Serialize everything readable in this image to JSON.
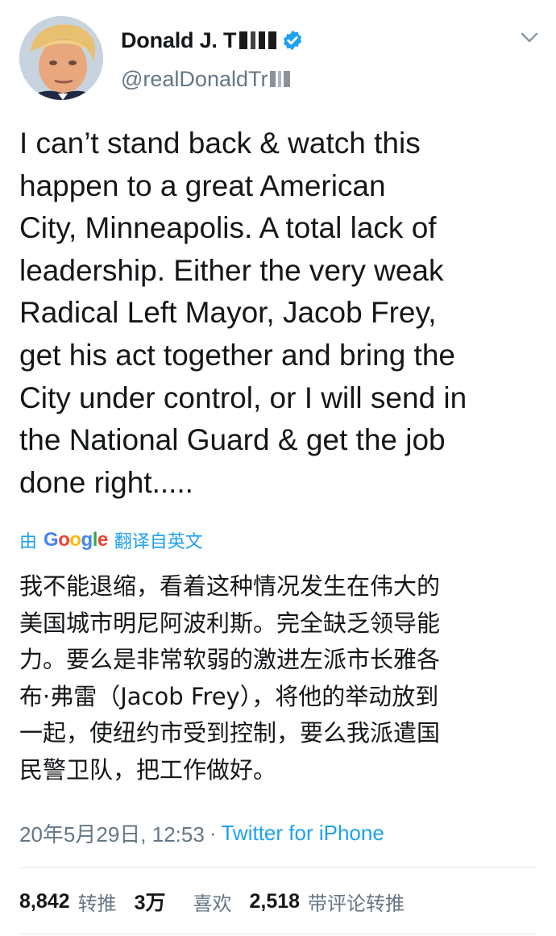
{
  "author": {
    "display_name": "Donald J. T",
    "handle": "@realDonaldTr",
    "verified": true
  },
  "tweet": {
    "text": "I can’t stand back & watch this\nhappen to a great American\nCity, Minneapolis. A total lack of\nleadership. Either the very weak\nRadical Left Mayor, Jacob Frey,\nget his act together and bring the\nCity under control, or I will send in\nthe National Guard & get the job\ndone right....."
  },
  "translation": {
    "prefix": "由",
    "google": [
      "G",
      "o",
      "o",
      "g",
      "l",
      "e"
    ],
    "suffix": "翻译自英文",
    "text": "我不能退缩，看着这种情况发生在伟大的\n美国城市明尼阿波利斯。完全缺乏领导能\n力。要么是非常软弱的激进左派市长雅各\n布·弗雷（Jacob Frey），将他的举动放到\n一起，使纽约市受到控制，要么我派遣国\n民警卫队，把工作做好。"
  },
  "meta": {
    "timestamp": "20年5月29日, 12:53",
    "separator": "·",
    "source": "Twitter for iPhone"
  },
  "stats": {
    "retweets": {
      "count": "8,842",
      "label": "转推"
    },
    "likes": {
      "count": "3万",
      "label": "喜欢"
    },
    "quotes": {
      "count": "2,518",
      "label": "带评论转推"
    }
  },
  "colors": {
    "link": "#1da1f2",
    "secondary_text": "#657786",
    "primary_text": "#14171a",
    "verified_badge": "#1da1f2"
  },
  "icons": [
    "verified-badge-icon",
    "chevron-down-icon"
  ]
}
